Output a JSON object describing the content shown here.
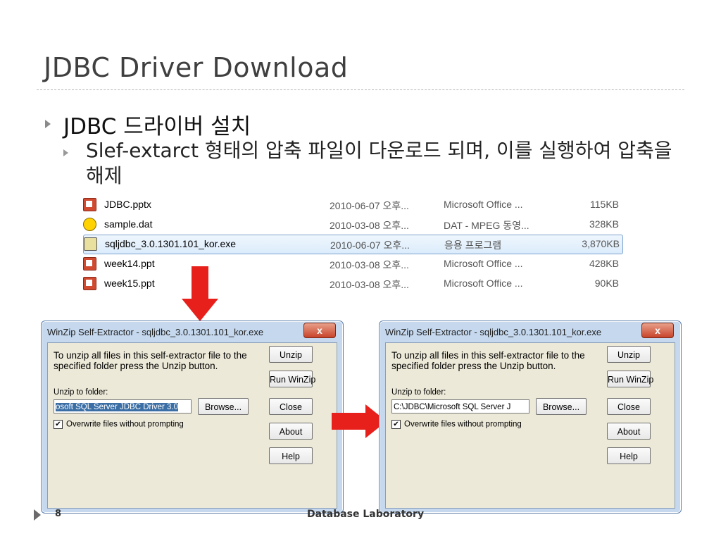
{
  "slide": {
    "title": "JDBC Driver Download",
    "bullet1": "JDBC 드라이버 설치",
    "bullet2": "Slef-extarct 형태의 압축 파일이 다운로드 되며, 이를 실행하여 압축을 해제"
  },
  "file_list": [
    {
      "name": "JDBC.pptx",
      "date": "2010-06-07 오후...",
      "type": "Microsoft Office ...",
      "size": "115KB",
      "icon": "pptx-file-icon"
    },
    {
      "name": "sample.dat",
      "date": "2010-03-08 오후...",
      "type": "DAT - MPEG 동영...",
      "size": "328KB",
      "icon": "dat-file-icon"
    },
    {
      "name": "sqljdbc_3.0.1301.101_kor.exe",
      "date": "2010-06-07 오후...",
      "type": "응용 프로그램",
      "size": "3,870KB",
      "icon": "exe-file-icon",
      "selected": true
    },
    {
      "name": "week14.ppt",
      "date": "2010-03-08 오후...",
      "type": "Microsoft Office ...",
      "size": "428KB",
      "icon": "ppt-file-icon"
    },
    {
      "name": "week15.ppt",
      "date": "2010-03-08 오후...",
      "type": "Microsoft Office ...",
      "size": "90KB",
      "icon": "ppt-file-icon"
    }
  ],
  "dialog_left": {
    "title": "WinZip Self-Extractor - sqljdbc_3.0.1301.101_kor.exe",
    "close_glyph": "x",
    "message": "To unzip all files in this self-extractor file to the specified folder press the Unzip button.",
    "folder_label": "Unzip to folder:",
    "folder_value": "osoft SQL Server JDBC Driver 3.0",
    "browse": "Browse...",
    "unzip": "Unzip",
    "run_winzip": "Run WinZip",
    "close": "Close",
    "about": "About",
    "help": "Help",
    "overwrite": "Overwrite files without prompting",
    "checkmark": "✔"
  },
  "dialog_right": {
    "title": "WinZip Self-Extractor - sqljdbc_3.0.1301.101_kor.exe",
    "close_glyph": "x",
    "message": "To unzip all files in this self-extractor file to the specified folder press the Unzip button.",
    "folder_label": "Unzip to folder:",
    "folder_value": "C:\\JDBC\\Microsoft SQL Server J",
    "browse": "Browse...",
    "unzip": "Unzip",
    "run_winzip": "Run WinZip",
    "close": "Close",
    "about": "About",
    "help": "Help",
    "overwrite": "Overwrite files without prompting",
    "checkmark": "✔"
  },
  "footer": {
    "page_number": "8",
    "text": "Database Laboratory"
  },
  "colors": {
    "arrow": "#e8201c",
    "selection": "#3a6ea5"
  }
}
